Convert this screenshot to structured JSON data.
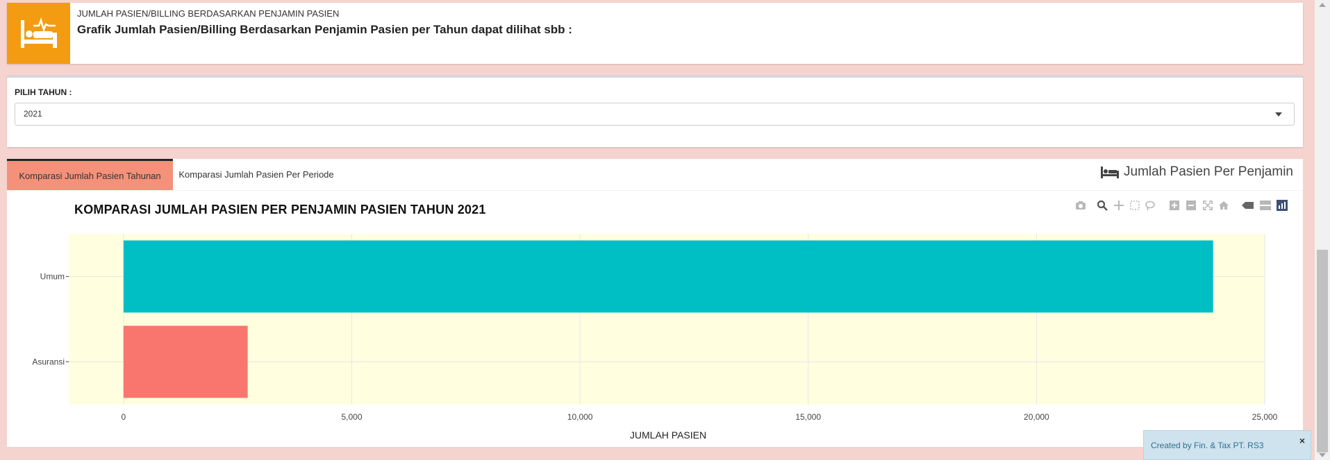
{
  "info_box": {
    "icon": "bed-pulse-icon",
    "small_text": "JUMLAH PASIEN/BILLING BERDASARKAN PENJAMIN PASIEN",
    "big_text": "Grafik Jumlah Pasien/Billing Berdasarkan Penjamin Pasien per Tahun dapat dilihat sbb :",
    "accent_color": "#f39c12"
  },
  "year_select": {
    "label": "PILIH TAHUN :",
    "value": "2021"
  },
  "tabs": {
    "items": [
      {
        "label": "Komparasi Jumlah Pasien Tahunan",
        "active": true
      },
      {
        "label": "Komparasi Jumlah Pasien Per Periode",
        "active": false
      }
    ],
    "header_title": "Jumlah Pasien Per Penjamin",
    "header_icon": "bed-icon"
  },
  "modebar": [
    "camera-icon",
    "zoom-icon",
    "pan-icon",
    "box-select-icon",
    "lasso-icon",
    "zoom-in-icon",
    "zoom-out-icon",
    "autoscale-icon",
    "reset-axes-icon",
    "spike-lines-icon",
    "compare-hover-icon",
    "plotly-logo-icon"
  ],
  "chart_data": {
    "type": "bar",
    "orientation": "horizontal",
    "title": "KOMPARASI JUMLAH PASIEN PER PENJAMIN PASIEN TAHUN 2021",
    "xlabel": "JUMLAH PASIEN",
    "ylabel": "",
    "categories": [
      "Umum",
      "Asuransi"
    ],
    "values": [
      23870,
      2720
    ],
    "bar_colors": [
      "#00bfc4",
      "#f8766d"
    ],
    "xlim": [
      -1200,
      25000
    ],
    "x_ticks": [
      0,
      5000,
      10000,
      15000,
      20000,
      25000
    ],
    "x_tick_labels": [
      "0",
      "5,000",
      "10,000",
      "15,000",
      "20,000",
      "25,000"
    ],
    "plot_background": "#ffffe0",
    "grid": true
  },
  "toast": {
    "text": "Created by Fin. & Tax PT. RS3",
    "close_label": "×"
  }
}
